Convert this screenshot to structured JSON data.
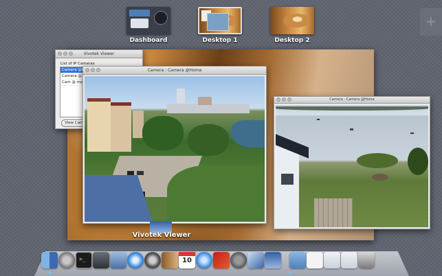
{
  "spaces": [
    {
      "label": "Dashboard"
    },
    {
      "label": "Desktop 1"
    },
    {
      "label": "Desktop 2"
    }
  ],
  "vivotek_window": {
    "title": "Vivotek Viewer",
    "list_header": "List of IP Cameras",
    "cameras": [
      "Camera @Home",
      "Camera @ livi...",
      "Cam @ my off..."
    ],
    "button": "View Camera"
  },
  "camera_window_1": {
    "title": "Camera : Camera @Home"
  },
  "camera_window_2": {
    "title": "Camera : Camera @Home"
  },
  "app_label": "Vivotek Viewer",
  "dock": {
    "icons": [
      "finder-icon",
      "launchpad-icon",
      "terminal-icon",
      "system-info-icon",
      "preview-icon",
      "safari-icon",
      "photo-booth-icon",
      "address-book-icon",
      "calendar-icon",
      "itunes-icon",
      "photo-icon",
      "system-preferences-icon",
      "xcode-icon",
      "vivotek-app-icon",
      "folder-icon",
      "document-icon",
      "screenshot-icon",
      "screenshot-icon-2",
      "trash-icon"
    ],
    "calendar_day": "10"
  }
}
